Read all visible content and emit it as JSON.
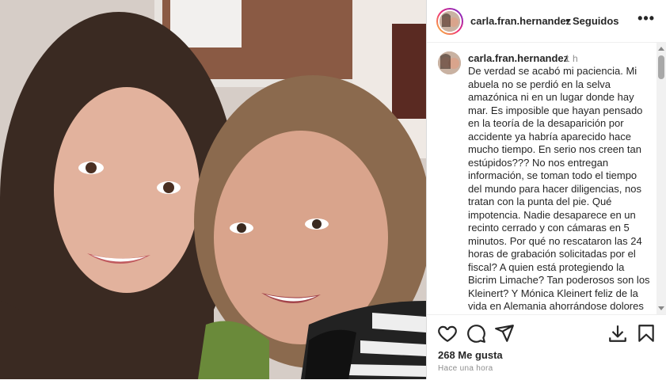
{
  "post": {
    "image_alt": "",
    "username": "carla.fran.hernandez",
    "separator": "•",
    "follow_label": "Seguidos",
    "more_label": "•••"
  },
  "comment": {
    "username": "carla.fran.hernandez",
    "time": "1 h",
    "text": "De verdad se acabó mi paciencia. Mi abuela no se perdió en la selva amazónica ni en un lugar donde hay mar. Es imposible que hayan pensado en la teoría de la desaparición por accidente ya habría aparecido hace mucho tiempo. En serio nos creen tan estúpidos??? No nos entregan información, se toman todo el tiempo del mundo para hacer diligencias, nos tratan con la punta del pie. Qué impotencia. Nadie desaparece en un recinto cerrado y con cámaras en 5 minutos.  Por qué no rescataron las 24 horas de grabación solicitadas por el fiscal? A quien está protegiendo la Bicrim Limache? Tan poderosos son los Kleinert? Y Mónica Kleinert feliz de la vida en Alemania ahorrándose dolores de cabeza. Chile país donde no hay"
  },
  "actions": {
    "likes": "268 Me gusta",
    "timestamp": "Hace una hora",
    "icons": [
      "heart-icon",
      "comment-icon",
      "share-icon",
      "download-icon",
      "bookmark-icon"
    ]
  },
  "colors": {
    "text": "#262626",
    "muted": "#8e8e8e",
    "border": "#dbdbdb"
  }
}
